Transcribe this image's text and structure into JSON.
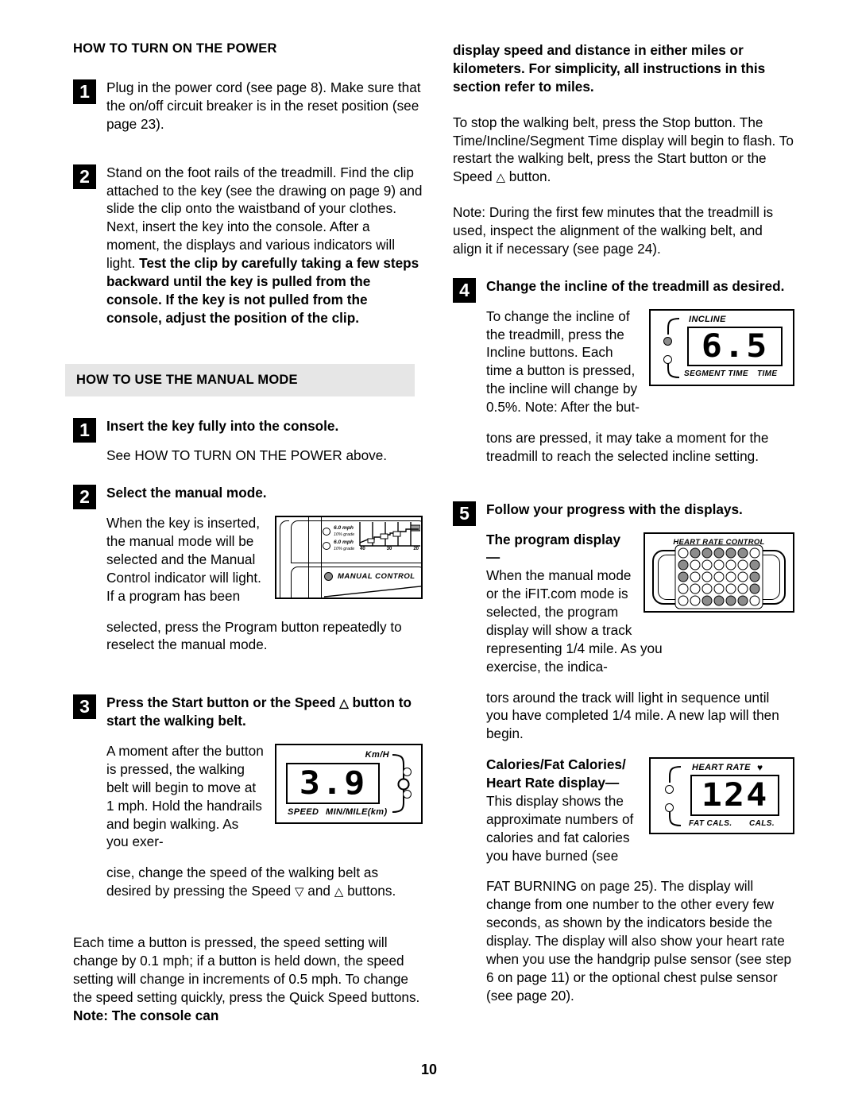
{
  "page": {
    "folio": "10"
  },
  "left_column": {
    "heading_power": "HOW TO TURN ON THE POWER",
    "power_steps": [
      {
        "num": "1",
        "text": "Plug in the power cord (see page 8). Make sure that the on/off circuit breaker is in the reset position (see page 23)."
      },
      {
        "num": "2",
        "text_plain": "Stand on the foot rails of the treadmill. Find the clip attached to the key (see the drawing on page 9) and slide the clip onto the waistband of your clothes. Next, insert the key into the console. After a moment, the displays and various indicators will light. ",
        "text_bold": "Test the clip by carefully taking a few steps backward until the key is pulled from the console. If the key is not pulled from the console, adjust the position of the clip."
      }
    ],
    "heading_manual": "HOW TO USE THE MANUAL MODE",
    "manual_steps": [
      {
        "num": "1",
        "title": "Insert the key fully into the console.",
        "body": "See HOW TO TURN ON THE POWER above."
      },
      {
        "num": "2",
        "title": "Select the manual mode.",
        "body_wrap": "When the key is inserted, the manual mode will be selected and the Manual Control indicator will light. If a program has been",
        "body_rest": "selected, press the Program button repeatedly to reselect the manual mode."
      },
      {
        "num": "3",
        "title_a": "Press the Start button or the Speed ",
        "title_tri": "△",
        "title_b": " button to start the walking belt.",
        "body_wrap": "A moment after the button is pressed, the walking belt will begin to move at 1 mph. Hold the handrails and begin walking. As you exer-",
        "body_rest_a": "cise, change the speed of the walking belt as desired by pressing the Speed ",
        "body_tri_down": "▽",
        "body_rest_b": " and ",
        "body_tri_up": "△",
        "body_rest_c": " buttons."
      }
    ],
    "closing_paragraph_plain": "Each time a button is pressed, the speed setting will change by 0.1 mph; if a button is held down, the speed setting will change in increments of 0.5 mph. To change the speed setting quickly, press the Quick Speed buttons. ",
    "closing_paragraph_bold": "Note: The console can"
  },
  "right_column": {
    "continuation_bold": "display speed and distance in either miles or kilometers. For simplicity, all instructions in this section refer to miles.",
    "stop_paragraph_a": "To stop the walking belt, press the Stop button. The Time/Incline/Segment Time display will begin to flash. To restart the walking belt, press the Start button or the Speed ",
    "stop_paragraph_tri": "△",
    "stop_paragraph_b": " button.",
    "note_paragraph": "Note: During the first few minutes that the treadmill is used, inspect the alignment of the walking belt, and align it if necessary (see page 24).",
    "steps": [
      {
        "num": "4",
        "title": "Change the incline of the treadmill as desired.",
        "body_wrap": "To change the incline of the treadmill, press the Incline buttons. Each time a button is pressed, the incline will change by 0.5%. Note: After the but-",
        "body_rest": "tons are pressed, it may take a moment for the treadmill to reach the selected incline setting."
      },
      {
        "num": "5",
        "title": "Follow your progress with the displays.",
        "sub_a_bold": "The program display—",
        "sub_a_wrap": "When the manual mode or the iFIT.com mode is selected, the program display will show a track representing 1/4 mile. As you exercise, the indica-",
        "sub_a_rest": "tors around the track will light in sequence until you have completed 1/4 mile. A new lap will then begin.",
        "sub_b_bold_1": "Calories/Fat Calories/",
        "sub_b_bold_2": "Heart Rate display—",
        "sub_b_wrap": "This display shows the approximate numbers of calories and fat calories you have burned (see",
        "sub_b_rest": "FAT BURNING on page 25). The display will change from one number to the other every few seconds, as shown by the indicators beside the display. The display will also show your heart rate when you use the handgrip pulse sensor (see step 6 on page 11) or the optional chest pulse sensor (see page 20)."
      }
    ]
  },
  "figures": {
    "manual_control": {
      "indicator_rows": [
        {
          "speed": "6.0 mph",
          "grade": "10% grade",
          "lit": false
        },
        {
          "speed": "6.0 mph",
          "grade": "10% grade",
          "lit": false
        }
      ],
      "scale_ticks": [
        "40",
        "30",
        "20"
      ],
      "manual_control_label": "MANUAL CONTROL",
      "manual_control_lit": true
    },
    "speed_display": {
      "value": "3.9",
      "unit_label": "Km/H",
      "left_label": "SPEED",
      "right_label": "MIN/MILE(km)",
      "leds": [
        false,
        false
      ]
    },
    "incline_display": {
      "value": "6.5",
      "top_label": "INCLINE",
      "bottom_label_1": "SEGMENT TIME",
      "bottom_label_2": "TIME",
      "leds": [
        true,
        false
      ]
    },
    "program_display": {
      "label": "HEART RATE CONTROL",
      "grid": [
        [
          false,
          true,
          true,
          true,
          true,
          true,
          false
        ],
        [
          true,
          false,
          false,
          false,
          false,
          false,
          true
        ],
        [
          true,
          false,
          false,
          false,
          false,
          false,
          true
        ],
        [
          false,
          false,
          false,
          false,
          false,
          false,
          true
        ],
        [
          false,
          false,
          true,
          true,
          true,
          true,
          false
        ]
      ]
    },
    "heart_rate_display": {
      "value": "124",
      "top_label": "HEART RATE",
      "heart_glyph": "♥",
      "bottom_label_1": "FAT CALS.",
      "bottom_label_2": "CALS.",
      "leds": [
        false,
        false
      ]
    }
  }
}
